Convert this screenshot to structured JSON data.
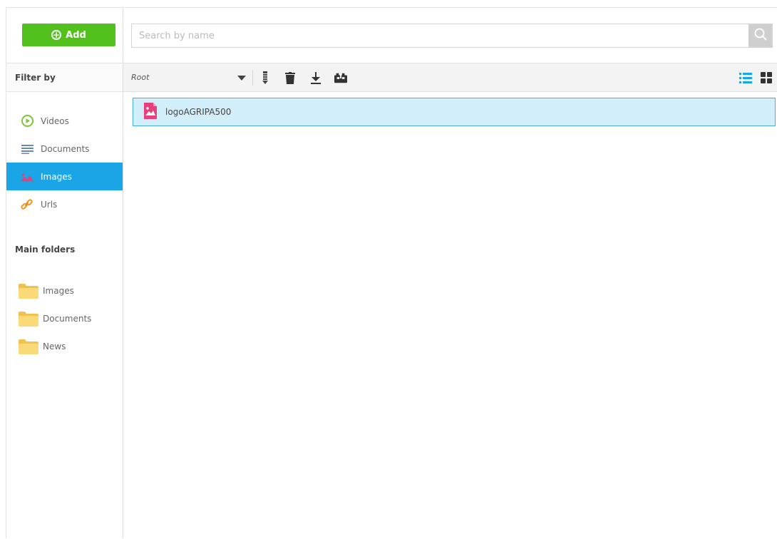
{
  "sidebar": {
    "add_label": "Add",
    "filter_title": "Filter by",
    "filters": [
      {
        "label": "Videos",
        "icon": "play-circle-icon",
        "active": false
      },
      {
        "label": "Documents",
        "icon": "lines-icon",
        "active": false
      },
      {
        "label": "Images",
        "icon": "image-icon",
        "active": true
      },
      {
        "label": "Urls",
        "icon": "link-icon",
        "active": false
      }
    ],
    "folders_title": "Main folders",
    "folders": [
      {
        "label": "Images"
      },
      {
        "label": "Documents"
      },
      {
        "label": "News"
      }
    ]
  },
  "search": {
    "placeholder": "Search by name",
    "value": ""
  },
  "toolbar": {
    "breadcrumb": "Root"
  },
  "files": [
    {
      "name": "logoAGRIPA500",
      "type": "image",
      "selected": true
    }
  ],
  "colors": {
    "add_button": "#52c11e",
    "active_filter": "#1aa6e6",
    "selected_row_bg": "#d3eefb",
    "selected_row_border": "#45ade0",
    "image_icon": "#e8407a",
    "folder": "#f7cf62"
  }
}
